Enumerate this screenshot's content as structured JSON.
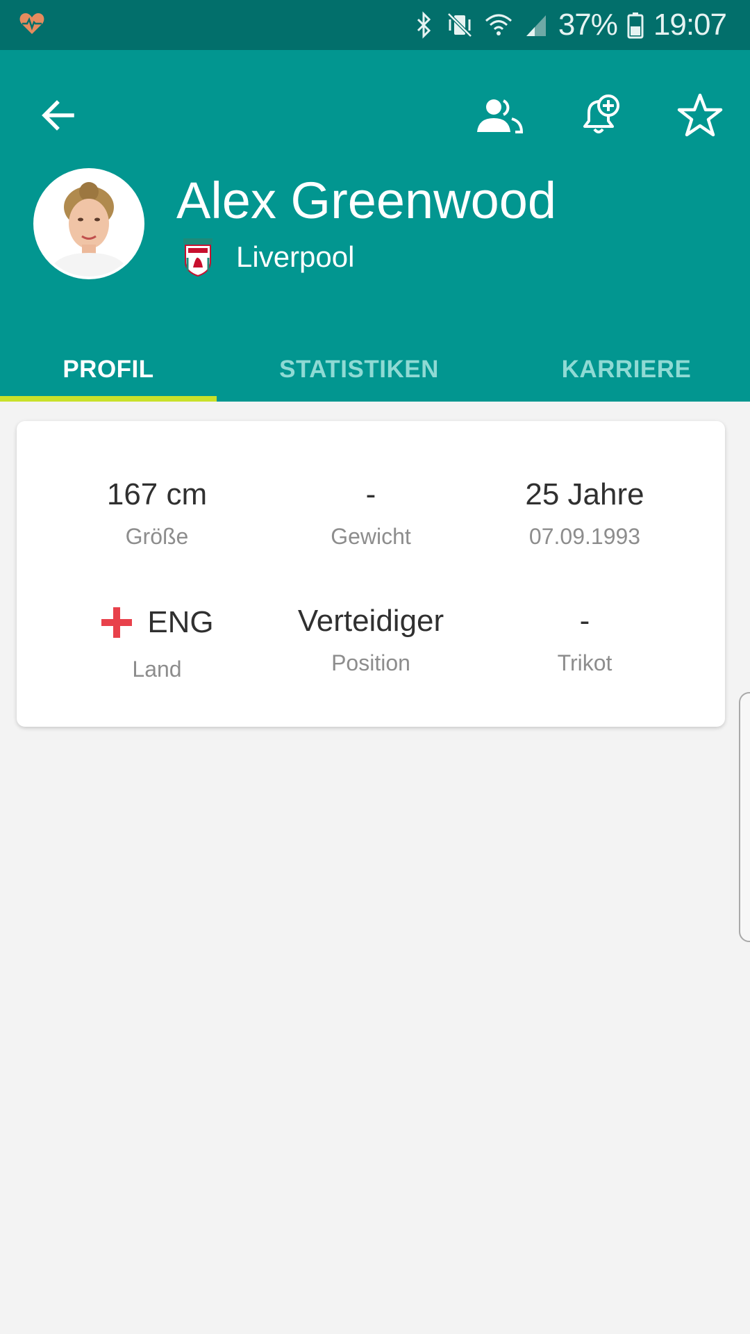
{
  "status_bar": {
    "icons": [
      "health-heart-icon",
      "bluetooth-icon",
      "vibrate-mute-icon",
      "wifi-icon",
      "signal-icon",
      "battery-icon"
    ],
    "battery": "37%",
    "time": "19:07"
  },
  "header": {
    "player_name": "Alex Greenwood",
    "club_name": "Liverpool",
    "actions": [
      "back",
      "squad",
      "add-alert",
      "favorite"
    ]
  },
  "tabs": [
    {
      "label": "PROFIL",
      "active": true
    },
    {
      "label": "STATISTIKEN",
      "active": false
    },
    {
      "label": "KARRIERE",
      "active": false
    }
  ],
  "profile": {
    "height": {
      "value": "167 cm",
      "label": "Größe"
    },
    "weight": {
      "value": "-",
      "label": "Gewicht"
    },
    "age": {
      "value": "25 Jahre",
      "label": "07.09.1993"
    },
    "country": {
      "value": "ENG",
      "label": "Land"
    },
    "position": {
      "value": "Verteidiger",
      "label": "Position"
    },
    "jersey": {
      "value": "-",
      "label": "Trikot"
    }
  },
  "colors": {
    "status_bar": "#026f6b",
    "header": "#029690",
    "tab_indicator": "#c9e12a",
    "inactive_tab": "#8fdad4",
    "background": "#f3f3f3"
  }
}
